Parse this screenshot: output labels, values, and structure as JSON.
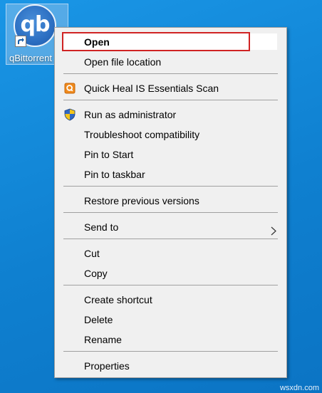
{
  "desktop": {
    "shortcut_label": "qBittorrent",
    "app_logo_text": "qb",
    "background_color": "#1287d6"
  },
  "context_menu": {
    "items": [
      {
        "label": "Open",
        "bold": true
      },
      {
        "label": "Open file location"
      },
      {
        "label": "Quick Heal IS Essentials Scan",
        "icon": "quick-heal-icon"
      },
      {
        "label": "Run as administrator",
        "icon": "uac-shield-icon"
      },
      {
        "label": "Troubleshoot compatibility"
      },
      {
        "label": "Pin to Start"
      },
      {
        "label": "Pin to taskbar"
      },
      {
        "label": "Restore previous versions"
      },
      {
        "label": "Send to",
        "submenu": true
      },
      {
        "label": "Cut"
      },
      {
        "label": "Copy"
      },
      {
        "label": "Create shortcut"
      },
      {
        "label": "Delete"
      },
      {
        "label": "Rename"
      },
      {
        "label": "Properties"
      }
    ],
    "highlight_color": "#d02323"
  },
  "watermark": "wsxdn.com"
}
